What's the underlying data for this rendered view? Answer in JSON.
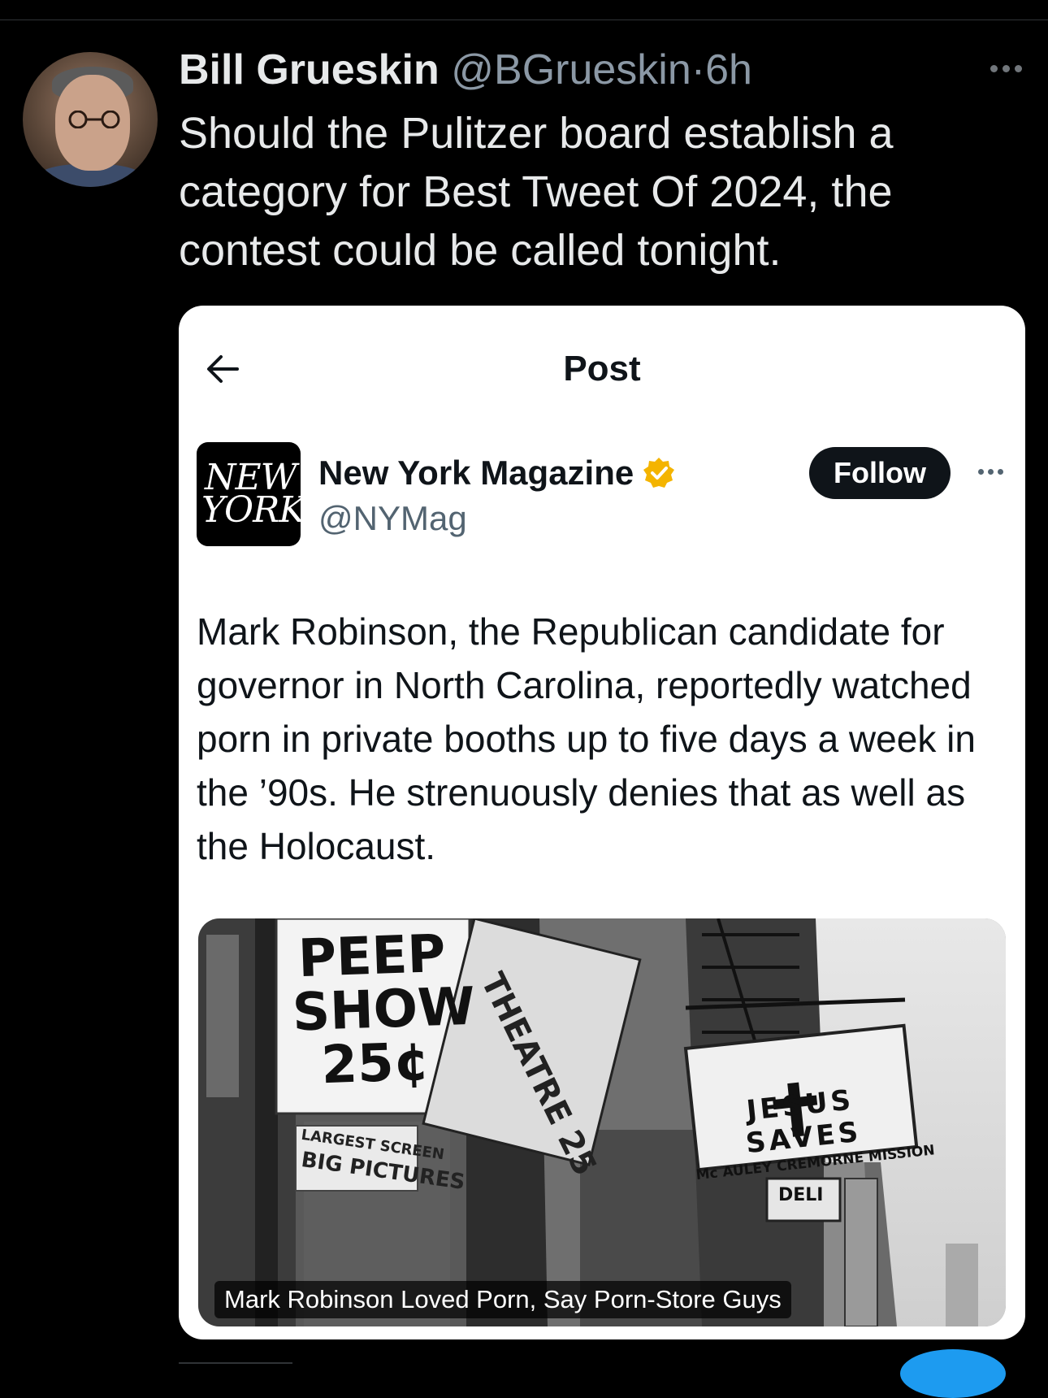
{
  "author": {
    "name": "Bill Grueskin",
    "handle": "@BGrueskin",
    "separator": "·",
    "time": "6h",
    "avatar_icon": "profile-photo"
  },
  "tweet": {
    "text": "Should the Pulitzer board establish a category for Best Tweet Of 2024, the contest could be called tonight."
  },
  "quoted": {
    "header_title": "Post",
    "logo_line1": "NEW",
    "logo_line2": "YORK",
    "account_name": "New York Magazine",
    "account_handle": "@NYMag",
    "follow_label": "Follow",
    "verified_color": "#f4b400",
    "text": "Mark Robinson, the Republican candidate for governor in North Carolina, reportedly watched porn in private booths up to five days a week in the ’90s. He strenuously denies that as well as the Holocaust.",
    "photo": {
      "sign_peep_l1": "PEEP",
      "sign_peep_l2": "SHOW",
      "sign_peep_l3": "25¢",
      "sign_theatre": "THEATRE 25",
      "sign_jesus": "JESUS SAVES",
      "sign_mission": "Mc AULEY CREMORNE MISSION",
      "sign_deli": "DELI",
      "sign_screen": "LARGEST SCREEN",
      "sign_big": "BIG PICTURES",
      "caption": "Mark Robinson Loved Porn, Say Porn-Store Guys"
    }
  },
  "colors": {
    "background": "#000000",
    "text_primary": "#e7e9ea",
    "text_secondary": "#8b98a5",
    "card_bg": "#ffffff",
    "follow_bg": "#0f1419"
  }
}
